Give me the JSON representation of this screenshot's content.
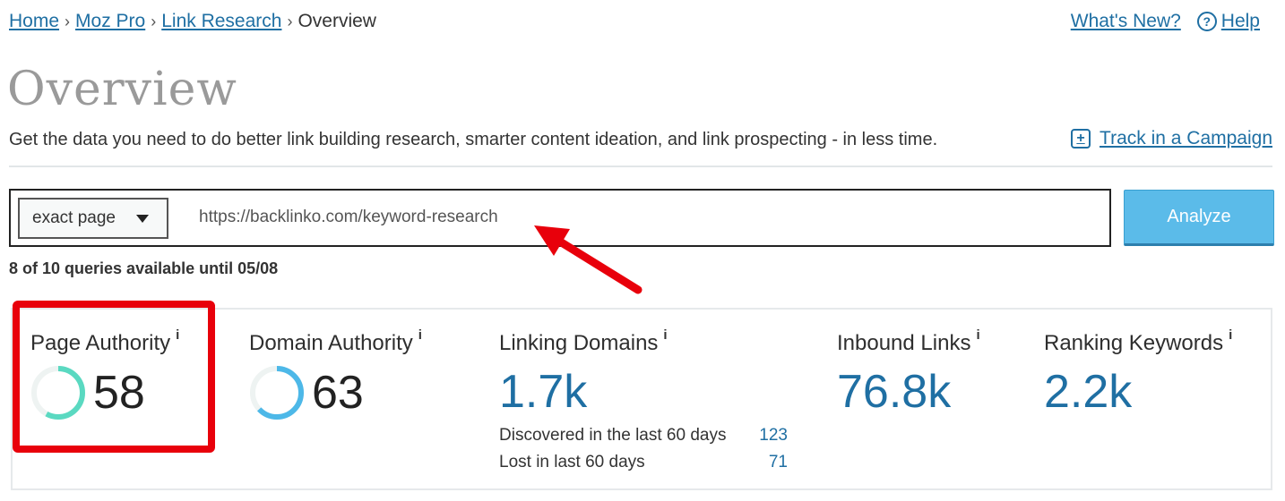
{
  "breadcrumb": {
    "items": [
      "Home",
      "Moz Pro",
      "Link Research"
    ],
    "current": "Overview"
  },
  "header_links": {
    "whats_new": "What's New?",
    "help": "Help"
  },
  "page": {
    "title": "Overview",
    "subtitle": "Get the data you need to do better link building research, smarter content ideation, and link prospecting - in less time.",
    "track_label": "Track in a Campaign"
  },
  "search": {
    "scope": "exact page",
    "url": "https://backlinko.com/keyword-research",
    "analyze_label": "Analyze",
    "queries_text": "8 of 10 queries available until 05/08"
  },
  "metrics": {
    "page_authority": {
      "label": "Page Authority",
      "value": "58",
      "progress": 0.58,
      "color": "#5ad9c1"
    },
    "domain_authority": {
      "label": "Domain Authority",
      "value": "63",
      "progress": 0.63,
      "color": "#4db8e8"
    },
    "linking_domains": {
      "label": "Linking Domains",
      "value": "1.7k",
      "discovered_label": "Discovered in the last 60 days",
      "discovered_value": "123",
      "lost_label": "Lost in last 60 days",
      "lost_value": "71"
    },
    "inbound_links": {
      "label": "Inbound Links",
      "value": "76.8k"
    },
    "ranking_keywords": {
      "label": "Ranking Keywords",
      "value": "2.2k"
    },
    "info_glyph": "i"
  },
  "colors": {
    "link": "#1f6fa3",
    "analyze": "#5bbbe9",
    "annotation_red": "#e8000b"
  }
}
